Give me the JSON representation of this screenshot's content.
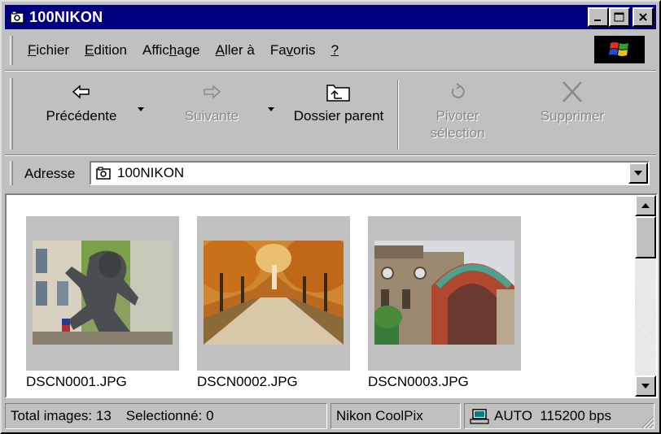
{
  "window": {
    "title": "100NIKON"
  },
  "menu": [
    {
      "pre": "",
      "key": "F",
      "post": "ichier"
    },
    {
      "pre": "",
      "key": "E",
      "post": "dition"
    },
    {
      "pre": "Affic",
      "key": "h",
      "post": "age"
    },
    {
      "pre": "",
      "key": "A",
      "post": "ller à"
    },
    {
      "pre": "Fa",
      "key": "v",
      "post": "oris"
    },
    {
      "pre": "",
      "key": "?",
      "post": ""
    }
  ],
  "toolbar": {
    "back": "Précédente",
    "forward": "Suivante",
    "up": "Dossier parent",
    "rotate_line1": "Pivoter",
    "rotate_line2": "sélection",
    "delete": "Supprimer"
  },
  "address": {
    "label": "Adresse",
    "value": "100NIKON"
  },
  "files": [
    {
      "name": "DSCN0001.JPG"
    },
    {
      "name": "DSCN0002.JPG"
    },
    {
      "name": "DSCN0003.JPG"
    }
  ],
  "status": {
    "total": "Total images: 13",
    "selected": "Selectionné: 0",
    "camera": "Nikon CoolPix",
    "connection": "AUTO  115200 bps"
  },
  "icons": {
    "window": "camera-folder-icon",
    "back": "left-arrow-icon",
    "forward": "right-arrow-icon",
    "up": "folder-up-icon",
    "rotate": "rotate-icon",
    "delete": "delete-x-icon",
    "connection": "computer-icon"
  }
}
